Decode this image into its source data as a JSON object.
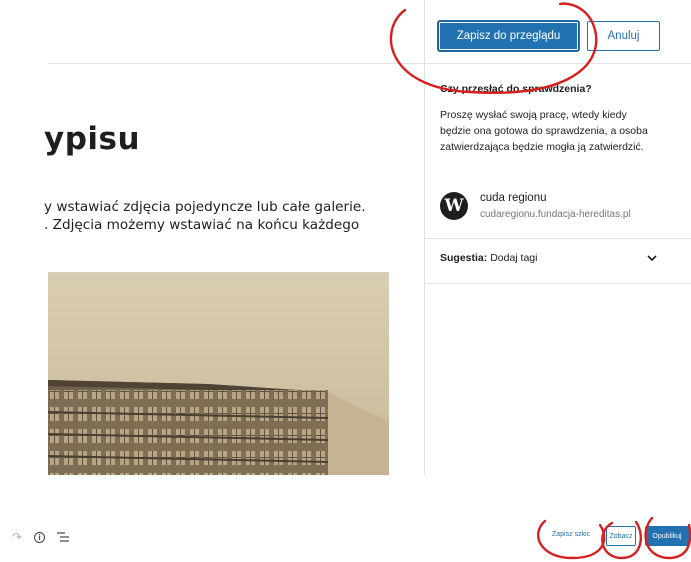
{
  "editor": {
    "title": "ypisu",
    "paragraph_line1": "y wstawiać zdjęcia pojedyncze lub całe galerie.",
    "paragraph_line2": ". Zdjęcia możemy wstawiać na końcu każdego"
  },
  "header": {
    "submit_label": "Zapisz do przeglądu",
    "cancel_label": "Anuluj"
  },
  "sidebar": {
    "heading": "Czy przesłać do sprawdzenia?",
    "description": "Proszę wysłać swoją pracę, wtedy kiedy będzie ona gotowa do sprawdzenia, a osoba zatwierdzająca będzie mogła ją zatwierdzić.",
    "site_name": "cuda regionu",
    "site_url": "cudaregionu.fundacja-hereditas.pl",
    "suggestion_label": "Sugestia:",
    "suggestion_text": "Dodaj tagi"
  },
  "footer": {
    "save_draft_label": "Zapisz szkic",
    "preview_label": "Zobacz",
    "publish_label": "Opublikuj"
  },
  "colors": {
    "accent": "#2271b1",
    "annotation": "#d61f1f"
  },
  "icons": {
    "logo": "wordpress-icon",
    "chevron": "chevron-down-icon",
    "redo": "redo-icon",
    "info": "info-icon",
    "outline": "list-view-icon"
  }
}
